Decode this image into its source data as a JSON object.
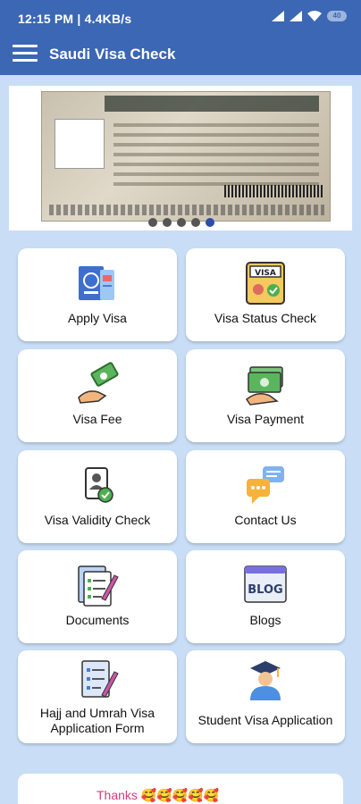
{
  "status": {
    "time": "12:15 PM | 4.4KB/s",
    "battery": "40"
  },
  "appbar": {
    "title": "Saudi Visa Check"
  },
  "banner": {
    "slides": 5,
    "active_slide": 5
  },
  "cards": [
    {
      "label": "Apply Visa",
      "icon": "passport-icon"
    },
    {
      "label": "Visa Status Check",
      "icon": "visa-card-icon"
    },
    {
      "label": "Visa Fee",
      "icon": "money-hand-icon"
    },
    {
      "label": "Visa Payment",
      "icon": "cash-payment-icon"
    },
    {
      "label": "Visa Validity Check",
      "icon": "id-check-icon"
    },
    {
      "label": "Contact Us",
      "icon": "chat-bubbles-icon"
    },
    {
      "label": "Documents",
      "icon": "documents-icon"
    },
    {
      "label": "Blogs",
      "icon": "blog-icon"
    },
    {
      "label": "Hajj and Umrah Visa Application Form",
      "icon": "form-edit-icon"
    },
    {
      "label": "Student Visa Application",
      "icon": "graduate-icon"
    }
  ],
  "footer": {
    "thanks": "Thanks 🥰🥰🥰🥰🥰"
  },
  "colors": {
    "primary": "#3b67b4",
    "background": "#c9def6"
  }
}
